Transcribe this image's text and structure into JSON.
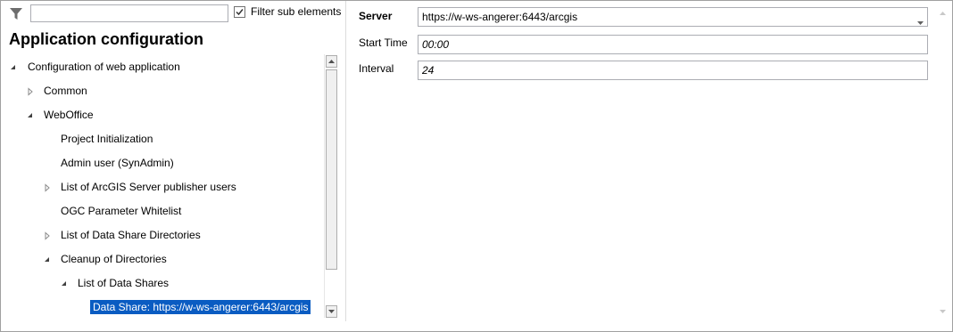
{
  "filter": {
    "input_value": "",
    "checkbox_label": "Filter sub elements",
    "checkbox_checked": true
  },
  "panel": {
    "title": "Application configuration"
  },
  "tree": {
    "items": [
      {
        "label": "Configuration of web application",
        "expander": "expanded"
      },
      {
        "label": "Common",
        "expander": "collapsed"
      },
      {
        "label": "WebOffice",
        "expander": "expanded"
      },
      {
        "label": "Project Initialization",
        "expander": "none"
      },
      {
        "label": "Admin user (SynAdmin)",
        "expander": "none"
      },
      {
        "label": "List of ArcGIS Server publisher users",
        "expander": "collapsed"
      },
      {
        "label": "OGC Parameter Whitelist",
        "expander": "none"
      },
      {
        "label": "List of Data Share Directories",
        "expander": "collapsed"
      },
      {
        "label": "Cleanup of Directories",
        "expander": "expanded"
      },
      {
        "label": "List of Data Shares",
        "expander": "expanded"
      },
      {
        "label": "Data Share: https://w-ws-angerer:6443/arcgis",
        "expander": "none",
        "selected": true
      }
    ]
  },
  "properties": {
    "server_label": "Server",
    "server_value": "https://w-ws-angerer:6443/arcgis",
    "start_time_label": "Start Time",
    "start_time_value": "00:00",
    "interval_label": "Interval",
    "interval_value": "24"
  },
  "colors": {
    "selection": "#0a5cc2",
    "border": "#abadb3"
  }
}
